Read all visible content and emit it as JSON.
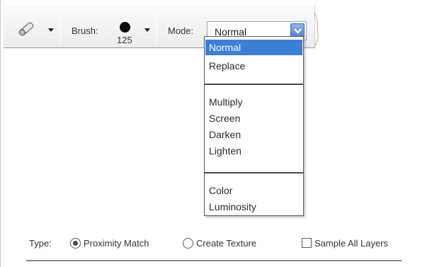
{
  "options_bar": {
    "tool_icon": "pencil-eraser-icon",
    "brush_label": "Brush:",
    "brush_size": "125",
    "mode_label": "Mode:",
    "mode_value": "Normal",
    "mode_button_icon": "chevron-down-icon"
  },
  "mode_dropdown": {
    "options": [
      "Normal",
      "Replace",
      "Multiply",
      "Screen",
      "Darken",
      "Lighten",
      "Color",
      "Luminosity"
    ],
    "selected": "Normal"
  },
  "bottom": {
    "type_label": "Type:",
    "proximity_label": "Proximity Match",
    "proximity_checked": true,
    "texture_label": "Create Texture",
    "texture_checked": false,
    "sample_label": "Sample All Layers",
    "sample_checked": false
  },
  "colors": {
    "selection": "#3d7fd4",
    "select_button": "#4f81c9"
  }
}
